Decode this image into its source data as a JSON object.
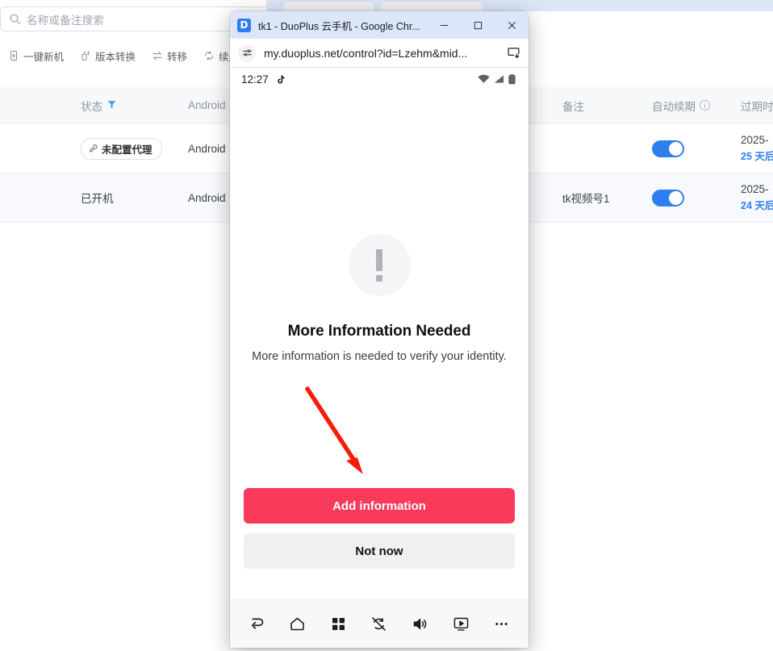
{
  "background_app": {
    "search": {
      "placeholder": "名称或备注搜索",
      "icon": "search-icon"
    },
    "toolbar": [
      {
        "label": "一键新机",
        "icon": "new-phone-icon"
      },
      {
        "label": "版本转换",
        "icon": "version-convert-icon"
      },
      {
        "label": "转移",
        "icon": "transfer-icon"
      },
      {
        "label": "续费",
        "icon": "renew-icon"
      }
    ],
    "table": {
      "columns": [
        {
          "key": "status",
          "label": "状态",
          "filter_icon": "filter-icon"
        },
        {
          "key": "android",
          "label": "Android"
        },
        {
          "key": "note",
          "label": "备注"
        },
        {
          "key": "auto_renew",
          "label": "自动续期",
          "info_icon": "info-icon"
        },
        {
          "key": "expire",
          "label": "过期时"
        }
      ],
      "rows": [
        {
          "status": "未配置代理",
          "status_type": "badge",
          "status_icon": "proxy-wrench-icon",
          "android": "Android",
          "note": "",
          "auto_renew": true,
          "expire_date": "2025-",
          "expire_left": "25 天后"
        },
        {
          "status": "已开机",
          "status_type": "text",
          "android": "Android",
          "note": "tk视频号1",
          "auto_renew": true,
          "expire_date": "2025-",
          "expire_left": "24 天后"
        }
      ]
    }
  },
  "chrome_window": {
    "favicon": "duoplus-favicon",
    "title": "tk1 - DuoPlus 云手机 - Google Chr...",
    "controls": [
      {
        "name": "minimize-button",
        "icon": "minimize-icon"
      },
      {
        "name": "maximize-button",
        "icon": "maximize-icon"
      },
      {
        "name": "close-button",
        "icon": "close-icon"
      }
    ],
    "address_bar": {
      "site_icon": "site-settings-icon",
      "url": "my.duoplus.net/control?id=Lzehm&mid...",
      "cast_icon": "cast-install-icon"
    }
  },
  "phone": {
    "status_bar": {
      "time": "12:27",
      "app_icon": "tiktok-icon",
      "right_icons": [
        "wifi-icon",
        "signal-icon",
        "battery-icon"
      ]
    },
    "dialog": {
      "icon": "exclamation-icon",
      "title": "More Information Needed",
      "subtitle": "More information is needed to verify your identity.",
      "primary_button": "Add information",
      "secondary_button": "Not now"
    },
    "nav_bar": [
      {
        "name": "back-icon"
      },
      {
        "name": "home-icon"
      },
      {
        "name": "apps-grid-icon"
      },
      {
        "name": "rotation-lock-off-icon"
      },
      {
        "name": "volume-icon"
      },
      {
        "name": "screen-record-icon"
      },
      {
        "name": "more-icon"
      }
    ]
  },
  "annotation": {
    "arrow_color": "#f41d07",
    "points_to": "Add information"
  }
}
